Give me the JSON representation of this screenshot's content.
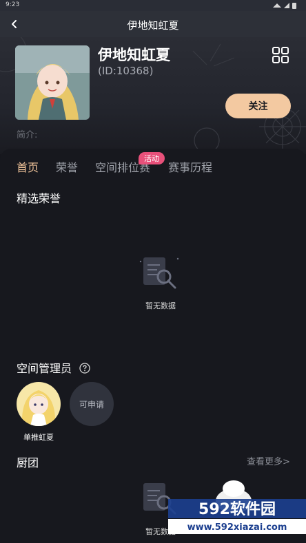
{
  "statusbar": {
    "time": "9:23"
  },
  "navbar": {
    "title": "伊地知虹夏"
  },
  "profile": {
    "name": "伊地知虹夏",
    "id_text": "(ID:10368)",
    "follow_label": "关注",
    "intro_label": "简介:"
  },
  "tabs": [
    {
      "label": "首页",
      "active": true
    },
    {
      "label": "荣誉"
    },
    {
      "label": "空间排位赛"
    },
    {
      "label": "赛事历程"
    }
  ],
  "tab_badge": "活动",
  "sections": {
    "honors_title": "精选荣誉",
    "honors_empty": "暂无数据",
    "admins_title": "空间管理员",
    "admins": [
      {
        "name": "单推虹夏"
      }
    ],
    "apply_label": "可申请",
    "kitchen_title": "厨团",
    "kitchen_more": "查看更多>",
    "kitchen_empty": "暂无数据"
  },
  "watermark": {
    "brand": "592软件园",
    "url": "www.592xiazai.com"
  },
  "colors": {
    "accent": "#f2c59b",
    "follow_bg": "#f3c9a1",
    "badge": "#e8507a",
    "background": "#16171d"
  }
}
